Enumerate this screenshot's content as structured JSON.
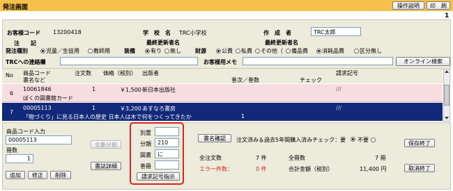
{
  "header": {
    "title": "発注画面",
    "help_label": "操作説明",
    "print_label": "印　刷",
    "page_number": "1"
  },
  "customer": {
    "code_label": "お客様コード",
    "code_value": "13200418",
    "school_label": "学　校　名",
    "school_value": "TRC小学校",
    "creator_label": "作　成　者",
    "creator_value": "TRC太郎",
    "last_update_label1": "最終更新者名",
    "note_label": "注　　記",
    "last_update_label2": "最終更新者名"
  },
  "order_type": {
    "label": "発注種別",
    "options": [
      "児童／生徒用",
      "教師用"
    ],
    "selected": 0,
    "binding_label": "装備",
    "binding_options": [
      "有り",
      "無し"
    ],
    "binding_selected": 0,
    "finance_label": "財源",
    "finance_options": [
      "公費",
      "私費",
      "その他（",
      "備品費",
      "消耗品費",
      "区分無し"
    ],
    "finance_selected": 0
  },
  "contact": {
    "trc_label": "TRCへの連絡欄",
    "memo_label": "お客様用メモ",
    "online_search_label": "オンライン検索"
  },
  "table": {
    "col_no": "No",
    "col_code": "商品コード",
    "col_title": "書名など",
    "col_qty": "注文数",
    "col_price": "価格（税別）",
    "col_publisher": "出版者",
    "col_volume": "巻次／巻数",
    "col_check": "チェック",
    "col_request": "請求記号",
    "rows": [
      {
        "no": "6",
        "code": "10061846",
        "qty": "1",
        "price": "￥1,500",
        "publisher": "新日本出版社",
        "title": "ぼくの図書館カード",
        "volume": "",
        "check": "",
        "request": "///",
        "selected": false
      },
      {
        "no": "7",
        "code": "00005113",
        "qty": "1",
        "price": "￥3,200",
        "publisher": "あすなろ書房",
        "title": "「物づくり」に見る日本人の歴史 日本人は木で何をつくってきたか",
        "volume": "1",
        "check": "",
        "request": "///",
        "selected": true
      }
    ]
  },
  "entry": {
    "code_input_label": "商品コード入力",
    "code_input_value": "00005113",
    "qty_label": "冊数",
    "qty_value": "1",
    "add_label": "追加",
    "edit_label": "修正",
    "delete_label": "削除",
    "split_label": "全集分割",
    "detail_label": "書誌詳細"
  },
  "request_panel": {
    "bekki_label": "別置",
    "bekki_value": "",
    "bunrui_label": "分類",
    "bunrui_value": "210",
    "tosho_label": "図書",
    "tosho_value": "に",
    "kansatsu_label": "巻冊",
    "kansatsu_value": "",
    "instruct_label": "請求記号指示"
  },
  "summary": {
    "confirm_label": "書名確認",
    "check_label": "注文済み＆過去5年間購入済みチェック：要",
    "check_options": [
      "要",
      "不要"
    ],
    "check_selected": 1,
    "not_needed_label": "不要",
    "total_orders_label": "全注文数",
    "total_orders_value": "7 件",
    "total_books_label": "全冊数",
    "total_books_value": "7 冊",
    "error_label": "エラー件数：",
    "error_value": "0 件",
    "total_price_label": "合計金額（税別）",
    "total_price_value": "11,400 円",
    "save_label": "保存終了",
    "cancel_label": "取消終了"
  },
  "colors": {
    "title_bar": "#f5c14a",
    "panel_bg": "#ecebdc",
    "selected_row": "#12297a",
    "row_pink": "#f7dde0",
    "error_red": "#e0201a",
    "highlight_red": "#e0201a"
  }
}
